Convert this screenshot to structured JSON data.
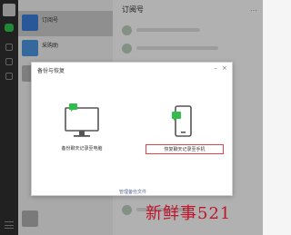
{
  "sidebar": {
    "icons": [
      "avatar",
      "chat-icon",
      "contacts-icon",
      "favorites-icon",
      "moments-icon",
      "menu-icon"
    ]
  },
  "chat_list": {
    "items": [
      {
        "title": "订阅号",
        "time": "",
        "subtitle": "",
        "icon_color": "#3a7bd5"
      },
      {
        "title": "采购助",
        "time": "",
        "subtitle": "",
        "icon_color": "#4a90d9"
      },
      {
        "title": "",
        "time": "",
        "subtitle": "",
        "icon_color": "#b0b0b0"
      },
      {
        "title": "",
        "time": "",
        "subtitle": "",
        "icon_color": "#aaaaaa"
      },
      {
        "title": "",
        "time": "",
        "subtitle": "",
        "icon_color": "#b5b5b5"
      }
    ]
  },
  "content": {
    "title": "订阅号",
    "more": "…"
  },
  "dialog": {
    "title": "备份与恢复",
    "min": "–",
    "close": "×",
    "options": [
      {
        "label": "备份聊天记录至电脑"
      },
      {
        "label": "恢复聊天记录至手机"
      }
    ],
    "link": "管理备份文件"
  },
  "watermark": "新鲜事521",
  "colors": {
    "sidebar": "#2e2e2e",
    "accent_green": "#2fbe4a",
    "link": "#576b95",
    "highlight_border": "#e04545",
    "watermark": "#c0142a"
  }
}
